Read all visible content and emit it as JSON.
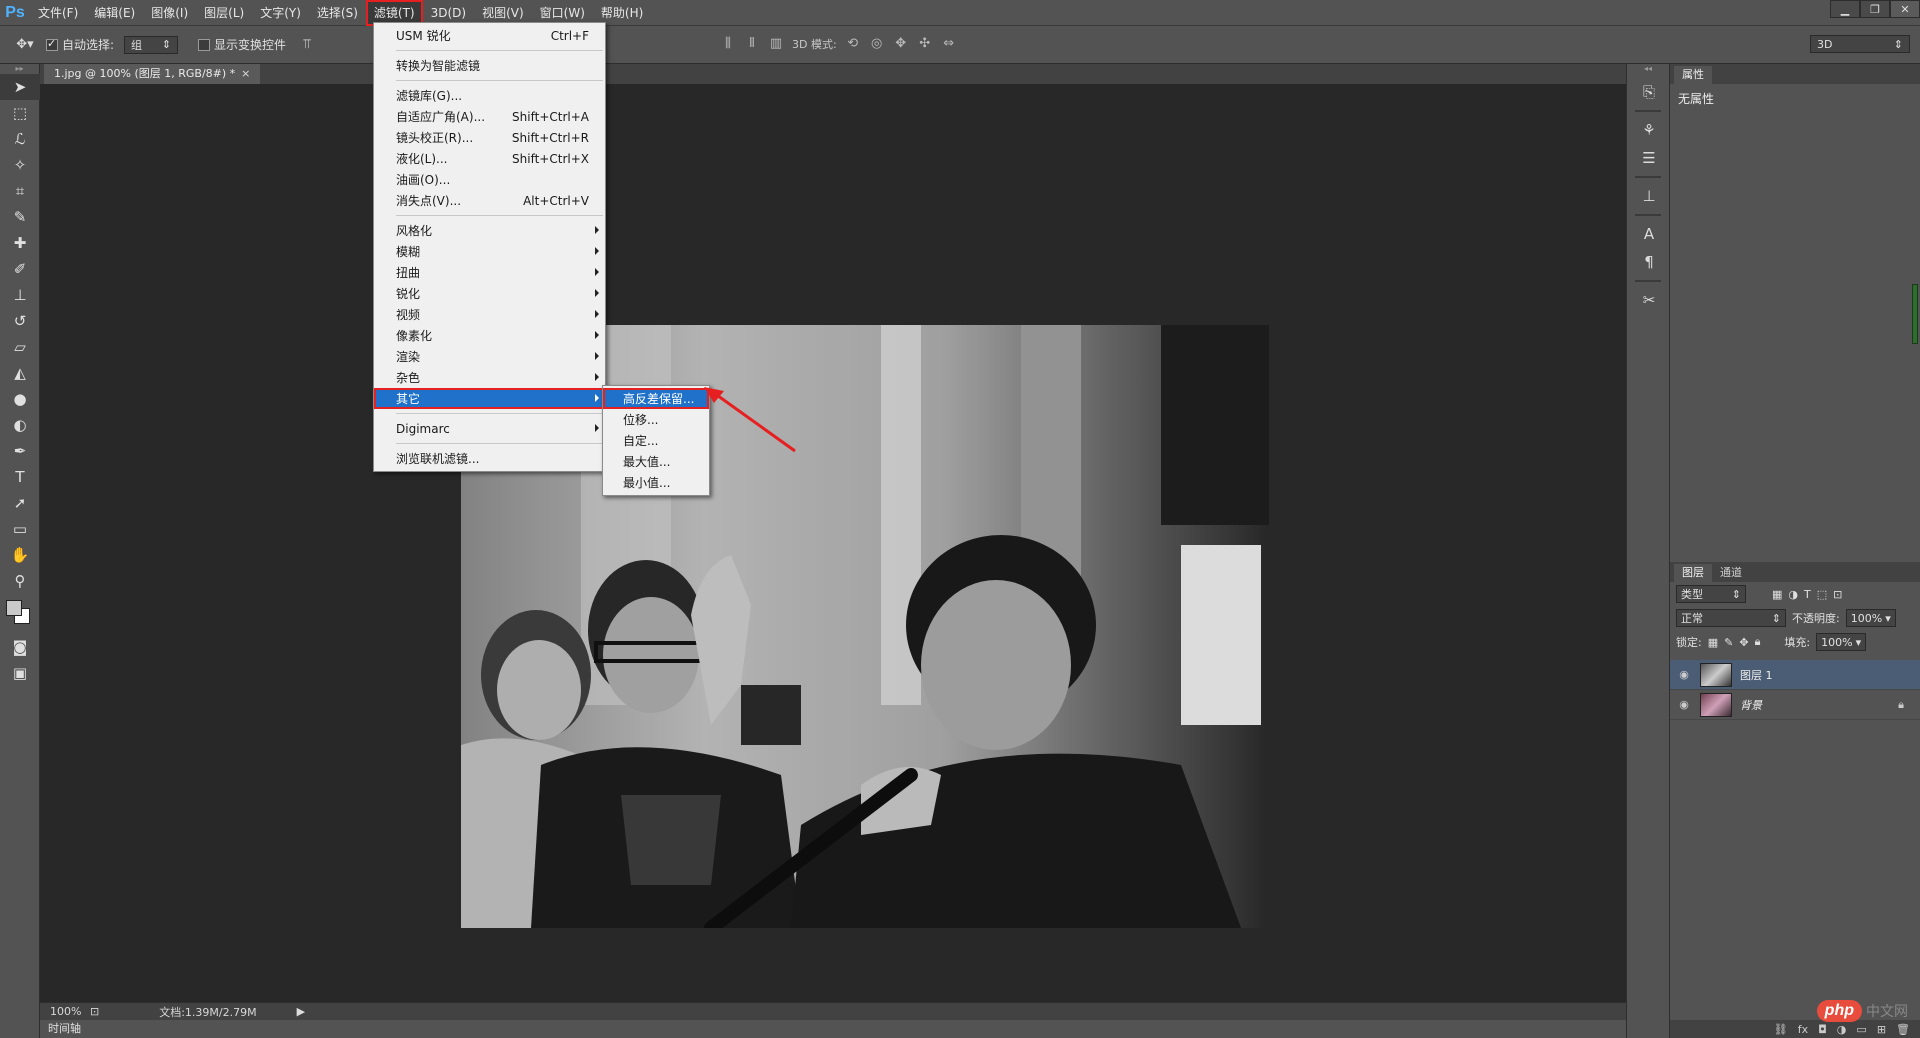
{
  "app": {
    "logo": "Ps"
  },
  "menubar": {
    "items": [
      "文件(F)",
      "编辑(E)",
      "图像(I)",
      "图层(L)",
      "文字(Y)",
      "选择(S)",
      "滤镜(T)",
      "3D(D)",
      "视图(V)",
      "窗口(W)",
      "帮助(H)"
    ],
    "active_index": 6
  },
  "options": {
    "auto_select_label": "自动选择:",
    "auto_select_value": "组",
    "show_transform_label": "显示变换控件",
    "mode3d_label": "3D 模式:",
    "workspace_value": "3D"
  },
  "document": {
    "tab_title": "1.jpg @ 100% (图层 1, RGB/8#) *",
    "close_glyph": "×"
  },
  "status": {
    "zoom": "100%",
    "doc_info": "文档:1.39M/2.79M"
  },
  "timeline": {
    "label": "时间轴"
  },
  "filter_menu": {
    "groups": [
      [
        {
          "label": "USM 锐化",
          "shortcut": "Ctrl+F"
        }
      ],
      [
        {
          "label": "转换为智能滤镜",
          "shortcut": ""
        }
      ],
      [
        {
          "label": "滤镜库(G)...",
          "shortcut": ""
        },
        {
          "label": "自适应广角(A)...",
          "shortcut": "Shift+Ctrl+A"
        },
        {
          "label": "镜头校正(R)...",
          "shortcut": "Shift+Ctrl+R"
        },
        {
          "label": "液化(L)...",
          "shortcut": "Shift+Ctrl+X"
        },
        {
          "label": "油画(O)...",
          "shortcut": ""
        },
        {
          "label": "消失点(V)...",
          "shortcut": "Alt+Ctrl+V"
        }
      ],
      [
        {
          "label": "风格化",
          "submenu": true
        },
        {
          "label": "模糊",
          "submenu": true
        },
        {
          "label": "扭曲",
          "submenu": true
        },
        {
          "label": "锐化",
          "submenu": true
        },
        {
          "label": "视频",
          "submenu": true
        },
        {
          "label": "像素化",
          "submenu": true
        },
        {
          "label": "渲染",
          "submenu": true
        },
        {
          "label": "杂色",
          "submenu": true
        },
        {
          "label": "其它",
          "submenu": true,
          "highlighted": true
        }
      ],
      [
        {
          "label": "Digimarc",
          "submenu": true
        }
      ],
      [
        {
          "label": "浏览联机滤镜...",
          "shortcut": ""
        }
      ]
    ]
  },
  "other_submenu": {
    "items": [
      "高反差保留...",
      "位移...",
      "自定...",
      "最大值...",
      "最小值..."
    ],
    "highlighted_index": 0
  },
  "properties_panel": {
    "tab": "属性",
    "body": "无属性"
  },
  "layers_panel": {
    "tabs": [
      "图层",
      "通道"
    ],
    "filter_value": "类型",
    "blend_mode": "正常",
    "opacity_label": "不透明度:",
    "opacity_value": "100%",
    "lock_label": "锁定:",
    "fill_label": "填充:",
    "fill_value": "100%",
    "layers": [
      {
        "name": "图层 1",
        "selected": true,
        "locked": false
      },
      {
        "name": "背景",
        "selected": false,
        "locked": true
      }
    ]
  },
  "watermark": {
    "logo": "php",
    "text": "中文网"
  },
  "colors": {
    "menu_highlight": "#1f71c9",
    "annotation_red": "#e62020",
    "panel_bg": "#535353",
    "canvas_bg": "#282828"
  }
}
